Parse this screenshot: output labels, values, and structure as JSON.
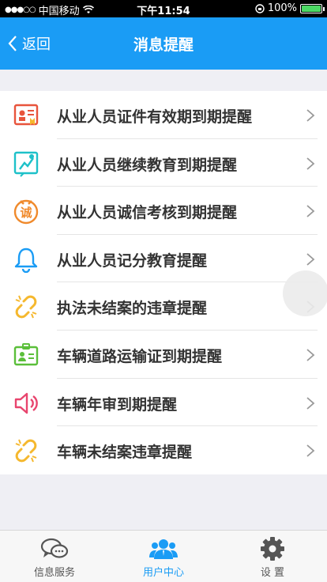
{
  "status_bar": {
    "carrier": "中国移动",
    "time": "下午11:54",
    "battery": "100%"
  },
  "nav": {
    "back_label": "返回",
    "title": "消息提醒"
  },
  "items": [
    {
      "label": "从业人员证件有效期到期提醒",
      "icon": "certificate-icon",
      "color": "#e8543c"
    },
    {
      "label": "从业人员继续教育到期提醒",
      "icon": "education-board-icon",
      "color": "#1ec1c9"
    },
    {
      "label": "从业人员诚信考核到期提醒",
      "icon": "integrity-badge-icon",
      "color": "#f08a2c"
    },
    {
      "label": "从业人员记分教育提醒",
      "icon": "bell-icon",
      "color": "#1a9cf5"
    },
    {
      "label": "执法未结案的违章提醒",
      "icon": "broken-link-icon",
      "color": "#f5b82e"
    },
    {
      "label": "车辆道路运输证到期提醒",
      "icon": "id-card-icon",
      "color": "#5bbf3a"
    },
    {
      "label": "车辆年审到期提醒",
      "icon": "speaker-icon",
      "color": "#e8456e"
    },
    {
      "label": "车辆未结案违章提醒",
      "icon": "broken-link-icon",
      "color": "#f5b82e"
    }
  ],
  "tabs": [
    {
      "label": "信息服务",
      "icon": "chat-bubbles-icon"
    },
    {
      "label": "用户中心",
      "icon": "users-icon"
    },
    {
      "label": "设 置",
      "icon": "gear-icon"
    }
  ]
}
